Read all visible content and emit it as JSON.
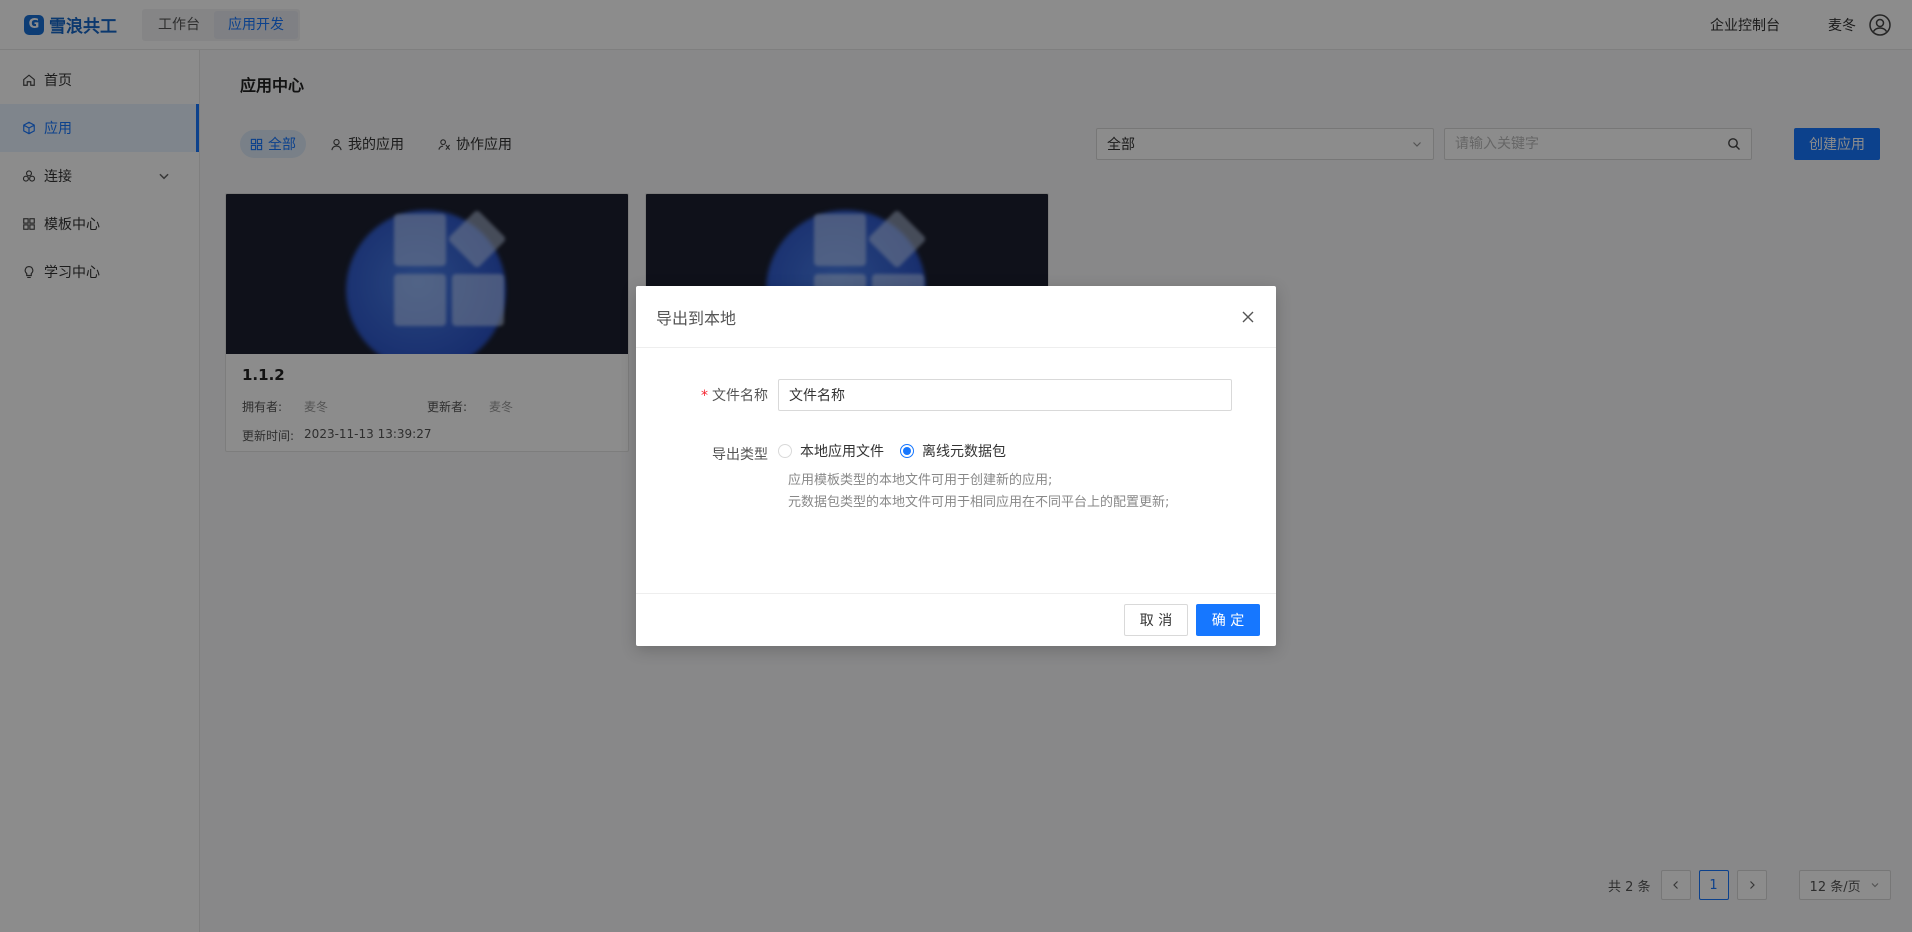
{
  "header": {
    "logo_mark": "G",
    "logo_text": "雪浪共工",
    "nav": [
      {
        "label": "工作台"
      },
      {
        "label": "应用开发"
      }
    ],
    "console_link": "企业控制台",
    "username": "麦冬"
  },
  "sidebar": {
    "items": [
      {
        "label": "首页",
        "icon": "home-icon"
      },
      {
        "label": "应用",
        "icon": "cube-icon"
      },
      {
        "label": "连接",
        "icon": "link-icon"
      },
      {
        "label": "模板中心",
        "icon": "grid-icon"
      },
      {
        "label": "学习中心",
        "icon": "bulb-icon"
      }
    ]
  },
  "main": {
    "title": "应用中心",
    "tabs": [
      {
        "label": "全部"
      },
      {
        "label": "我的应用"
      },
      {
        "label": "协作应用"
      }
    ],
    "select_value": "全部",
    "search_placeholder": "请输入关键字",
    "create_label": "创建应用",
    "cards": [
      {
        "title": "1.1.2",
        "owner_label": "拥有者:",
        "owner": "麦冬",
        "updater_label": "更新者:",
        "updater": "麦冬",
        "time_label": "更新时间:",
        "time": "2023-11-13 13:39:27"
      }
    ],
    "pagination": {
      "total": "共 2 条",
      "current": "1",
      "page_size": "12 条/页"
    }
  },
  "modal": {
    "title": "导出到本地",
    "file_label": "文件名称",
    "file_value": "文件名称",
    "type_label": "导出类型",
    "options": [
      "本地应用文件",
      "离线元数据包"
    ],
    "hint_1": "应用模板类型的本地文件可用于创建新的应用;",
    "hint_2": "元数据包类型的本地文件可用于相同应用在不同平台上的配置更新;",
    "cancel_label": "取 消",
    "ok_label": "确 定"
  },
  "colors": {
    "primary": "#1677ff",
    "overlay": "rgba(0,0,0,0.45)"
  }
}
